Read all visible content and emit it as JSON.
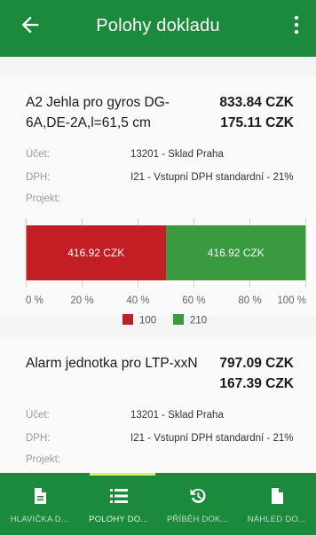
{
  "appbar": {
    "title": "Polohy dokladu",
    "back_icon": "arrow-left-icon",
    "menu_icon": "more-vertical-icon",
    "color": "#1c8a3d"
  },
  "items": [
    {
      "name": "A2 Jehla pro gyros DG-6A,DE-2A,l=61,5 cm",
      "amount": "833.84 CZK",
      "vat_amount": "175.11 CZK",
      "account_label": "Účet:",
      "account_value": "13201 - Sklad Praha",
      "vat_label": "DPH:",
      "vat_value": "I21 - Vstupní DPH standardní - 21%",
      "project_label": "Projekt:"
    },
    {
      "name": "Alarm jednotka pro LTP-xxN",
      "amount": "797.09 CZK",
      "vat_amount": "167.39 CZK",
      "account_label": "Účet:",
      "account_value": "13201 - Sklad Praha",
      "vat_label": "DPH:",
      "vat_value": "I21 - Vstupní DPH standardní - 21%",
      "project_label": "Projekt:"
    }
  ],
  "chart_data": {
    "type": "bar",
    "orientation": "horizontal-stacked",
    "series": [
      {
        "name": "100",
        "value": 50,
        "label": "416.92 CZK",
        "color": "#c21e24"
      },
      {
        "name": "210",
        "value": 50,
        "label": "416.92 CZK",
        "color": "#3a9a40"
      }
    ],
    "x_ticks": [
      "0 %",
      "20 %",
      "40 %",
      "60 %",
      "80 %",
      "100 %"
    ],
    "xlim": [
      0,
      100
    ],
    "legend_position": "bottom"
  },
  "bottom_nav": [
    {
      "label": "HLAVIČKA D...",
      "icon": "document-icon",
      "active": false
    },
    {
      "label": "POLOHY DO...",
      "icon": "list-icon",
      "active": true
    },
    {
      "label": "PŘÍBĚH DOK...",
      "icon": "history-icon",
      "active": false
    },
    {
      "label": "NÁHLED DO...",
      "icon": "file-icon",
      "active": false
    }
  ]
}
